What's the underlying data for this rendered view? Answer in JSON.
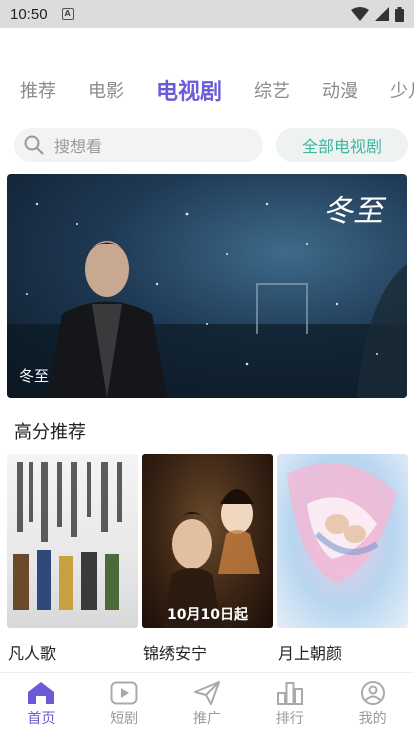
{
  "status_bar": {
    "time": "10:50",
    "sim_label": "A"
  },
  "tabs": [
    {
      "label": "推荐",
      "active": false
    },
    {
      "label": "电影",
      "active": false
    },
    {
      "label": "电视剧",
      "active": true
    },
    {
      "label": "综艺",
      "active": false
    },
    {
      "label": "动漫",
      "active": false
    },
    {
      "label": "少儿",
      "active": false
    }
  ],
  "search": {
    "placeholder": "搜想看",
    "all_button": "全部电视剧"
  },
  "banner": {
    "caption": "冬至",
    "logo_text": "冬至"
  },
  "section": {
    "title": "高分推荐"
  },
  "cards": [
    {
      "title": "凡人歌",
      "date_overlay": ""
    },
    {
      "title": "锦绣安宁",
      "date_overlay": "10月10日起"
    },
    {
      "title": "月上朝颜",
      "date_overlay": ""
    }
  ],
  "bottom_nav": [
    {
      "label": "首页",
      "icon": "home-icon",
      "active": true
    },
    {
      "label": "短剧",
      "icon": "play-icon",
      "active": false
    },
    {
      "label": "推广",
      "icon": "send-icon",
      "active": false
    },
    {
      "label": "排行",
      "icon": "ranking-icon",
      "active": false
    },
    {
      "label": "我的",
      "icon": "profile-icon",
      "active": false
    }
  ],
  "colors": {
    "accent": "#6b5bd6",
    "teal": "#3fb6a0",
    "muted": "#9a9a9a"
  }
}
